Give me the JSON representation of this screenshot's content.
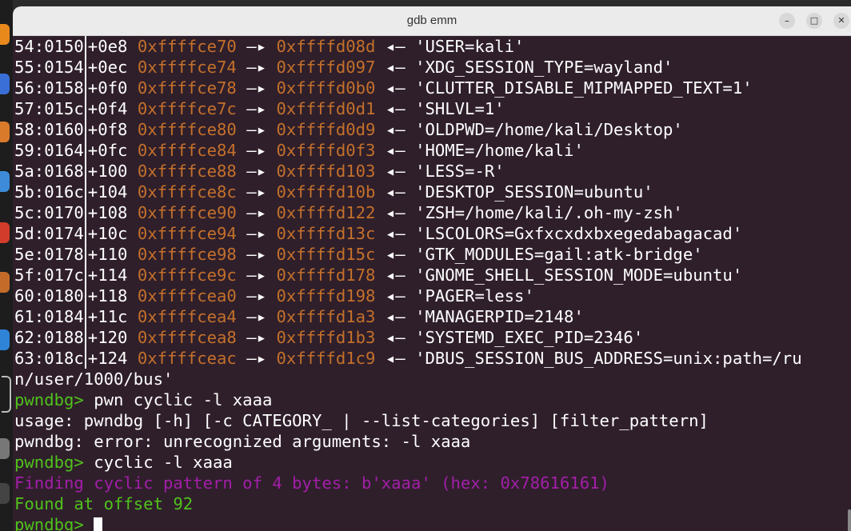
{
  "window": {
    "title": "gdb emm",
    "minimize_label": "–",
    "maximize_label": "□",
    "close_label": "✕"
  },
  "colors": {
    "background": "#2f1f2b",
    "address": "#c4702b",
    "prompt": "#4fc21b",
    "cyclic_info": "#a21fa8"
  },
  "stack_rows": [
    {
      "idx": "54:0150",
      "off": "+0e8",
      "addr": "0xffffce70",
      "arrow": "—▸",
      "ptr": "0xffffd08d",
      "back": "◂—",
      "str": "'USER=kali'"
    },
    {
      "idx": "55:0154",
      "off": "+0ec",
      "addr": "0xffffce74",
      "arrow": "—▸",
      "ptr": "0xffffd097",
      "back": "◂—",
      "str": "'XDG_SESSION_TYPE=wayland'"
    },
    {
      "idx": "56:0158",
      "off": "+0f0",
      "addr": "0xffffce78",
      "arrow": "—▸",
      "ptr": "0xffffd0b0",
      "back": "◂—",
      "str": "'CLUTTER_DISABLE_MIPMAPPED_TEXT=1'"
    },
    {
      "idx": "57:015c",
      "off": "+0f4",
      "addr": "0xffffce7c",
      "arrow": "—▸",
      "ptr": "0xffffd0d1",
      "back": "◂—",
      "str": "'SHLVL=1'"
    },
    {
      "idx": "58:0160",
      "off": "+0f8",
      "addr": "0xffffce80",
      "arrow": "—▸",
      "ptr": "0xffffd0d9",
      "back": "◂—",
      "str": "'OLDPWD=/home/kali/Desktop'"
    },
    {
      "idx": "59:0164",
      "off": "+0fc",
      "addr": "0xffffce84",
      "arrow": "—▸",
      "ptr": "0xffffd0f3",
      "back": "◂—",
      "str": "'HOME=/home/kali'"
    },
    {
      "idx": "5a:0168",
      "off": "+100",
      "addr": "0xffffce88",
      "arrow": "—▸",
      "ptr": "0xffffd103",
      "back": "◂—",
      "str": "'LESS=-R'"
    },
    {
      "idx": "5b:016c",
      "off": "+104",
      "addr": "0xffffce8c",
      "arrow": "—▸",
      "ptr": "0xffffd10b",
      "back": "◂—",
      "str": "'DESKTOP_SESSION=ubuntu'"
    },
    {
      "idx": "5c:0170",
      "off": "+108",
      "addr": "0xffffce90",
      "arrow": "—▸",
      "ptr": "0xffffd122",
      "back": "◂—",
      "str": "'ZSH=/home/kali/.oh-my-zsh'"
    },
    {
      "idx": "5d:0174",
      "off": "+10c",
      "addr": "0xffffce94",
      "arrow": "—▸",
      "ptr": "0xffffd13c",
      "back": "◂—",
      "str": "'LSCOLORS=Gxfxcxdxbxegedabagacad'"
    },
    {
      "idx": "5e:0178",
      "off": "+110",
      "addr": "0xffffce98",
      "arrow": "—▸",
      "ptr": "0xffffd15c",
      "back": "◂—",
      "str": "'GTK_MODULES=gail:atk-bridge'"
    },
    {
      "idx": "5f:017c",
      "off": "+114",
      "addr": "0xffffce9c",
      "arrow": "—▸",
      "ptr": "0xffffd178",
      "back": "◂—",
      "str": "'GNOME_SHELL_SESSION_MODE=ubuntu'"
    },
    {
      "idx": "60:0180",
      "off": "+118",
      "addr": "0xffffcea0",
      "arrow": "—▸",
      "ptr": "0xffffd198",
      "back": "◂—",
      "str": "'PAGER=less'"
    },
    {
      "idx": "61:0184",
      "off": "+11c",
      "addr": "0xffffcea4",
      "arrow": "—▸",
      "ptr": "0xffffd1a3",
      "back": "◂—",
      "str": "'MANAGERPID=2148'"
    },
    {
      "idx": "62:0188",
      "off": "+120",
      "addr": "0xffffcea8",
      "arrow": "—▸",
      "ptr": "0xffffd1b3",
      "back": "◂—",
      "str": "'SYSTEMD_EXEC_PID=2346'"
    },
    {
      "idx": "63:018c",
      "off": "+124",
      "addr": "0xffffceac",
      "arrow": "—▸",
      "ptr": "0xffffd1c9",
      "back": "◂—",
      "str": "'DBUS_SESSION_BUS_ADDRESS=unix:path=/ru"
    }
  ],
  "wrap_line": "n/user/1000/bus'",
  "prompt": "pwndbg>",
  "cmd1": " pwn cyclic -l xaaa",
  "usage_line": "usage: pwndbg [-h] [-c CATEGORY_ | --list-categories] [filter_pattern]",
  "error_line": "pwndbg: error: unrecognized arguments: -l xaaa",
  "cmd2": " cyclic -l xaaa",
  "finding_line": "Finding cyclic pattern of 4 bytes: b'xaaa' (hex: 0x78616161)",
  "found_line": "Found at offset 92",
  "cmd3": " "
}
